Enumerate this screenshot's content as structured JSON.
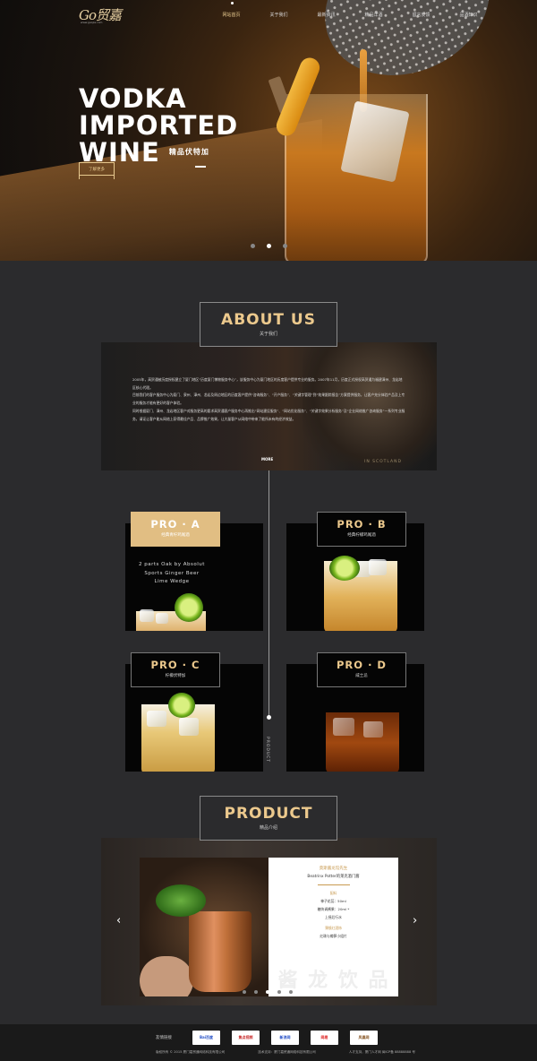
{
  "nav": {
    "logo_text": "Go贸嘉",
    "logo_sub": "www.gaojia.com",
    "items": [
      {
        "label": "网站首页",
        "active": true
      },
      {
        "label": "关于我们",
        "active": false
      },
      {
        "label": "最新资讯",
        "active": false
      },
      {
        "label": "精品洋酒",
        "active": false
      },
      {
        "label": "留言反馈",
        "active": false
      },
      {
        "label": "品酒知识",
        "active": false
      }
    ]
  },
  "hero": {
    "line1": "VODKA",
    "line2": "IMPORTED",
    "line3": "WINE",
    "subtitle": "精品伏特加",
    "button_label": "了解更多",
    "slide_count": 3,
    "active_slide": 2
  },
  "about": {
    "title": "ABOUT US",
    "subtitle": "关于我们",
    "paragraphs": [
      "2005年，高贸通被历度授权建立了厦门地区“历度厦门博物服务中心”，该服务中心为厦门地区的历度客户提供专业的服务。2007年11月，历度正式授权高贸通为福建漳州、龙岩地区核心代理。",
      "目前我们的客户服务中心为厦门、泉州、漳州、龙岩及周边地区的历度客户提供“咨询服务”、“开户服务”、“关键字管理”到“效果跟踪报告”方案提供服务，让客户充分体验产品及上专业的服务才能有更好的客户体验。",
      "同时根据厦门、漳州、龙岩地区客户对服务更高的要求高贸通客户服务中心再推出“网站建设服务”、“网站优化服务”、“关键字效果分析服务”及“企业网络推广咨询服务”一系列专业服务，请证让客户能从网络上获得最佳产品、品牌推广效果，让大量客户从网络中带来了能所未有的经济效益。"
    ],
    "more_label": "MORE",
    "bottle_text": "IN SCOTLAND"
  },
  "timeline_label": "PRODUCT",
  "pros": [
    {
      "title": "PRO · A",
      "subtitle": "经典青柠鸡尾酒",
      "active": true
    },
    {
      "title": "PRO · B",
      "subtitle": "经典柠檬鸡尾酒",
      "active": false
    },
    {
      "title": "PRO · C",
      "subtitle": "柠檬伏特加",
      "active": false
    },
    {
      "title": "PRO · D",
      "subtitle": "威士忌",
      "active": false
    }
  ],
  "pro_a_desc": [
    "2 parts Oak by Absolut",
    "Sports Ginger Beer",
    "Lime Wedge"
  ],
  "product": {
    "title": "PRODUCT",
    "subtitle": "精品介绍",
    "card_name": "莫斯酱龙馆先生",
    "card_sub": "Beatrinx Potter的莱克酒门酱",
    "ingredients_label": "配料",
    "ingredients": [
      "神子花蕊：50ml",
      "糖块调酱果：20ml *",
      "上摇后行水"
    ],
    "method_label": "薄镜红酒饰",
    "method": "红珠与樽萝小组片",
    "watermark": "酱 龙 饮 品",
    "prev_arrow": "‹",
    "next_arrow": "›",
    "dot_count": 5,
    "active_dot": 2
  },
  "footer": {
    "friend_label": "友情链接",
    "partners": [
      "Bai百度",
      "焦点视频",
      "新浪网",
      "网易",
      "凤凰网"
    ],
    "copyright_left": "版权所有 © 2015 厦门嘉贸通网络科技有限公司",
    "copyright_mid": "技术支持：厦门嘉贸通网络科技有限公司",
    "copyright_right": "人才支持，厦门人才网 闽ICP备 88888888 号"
  },
  "colors": {
    "accent": "#ecc98d",
    "active_card": "#e1be83",
    "background": "#2b2b2d"
  }
}
